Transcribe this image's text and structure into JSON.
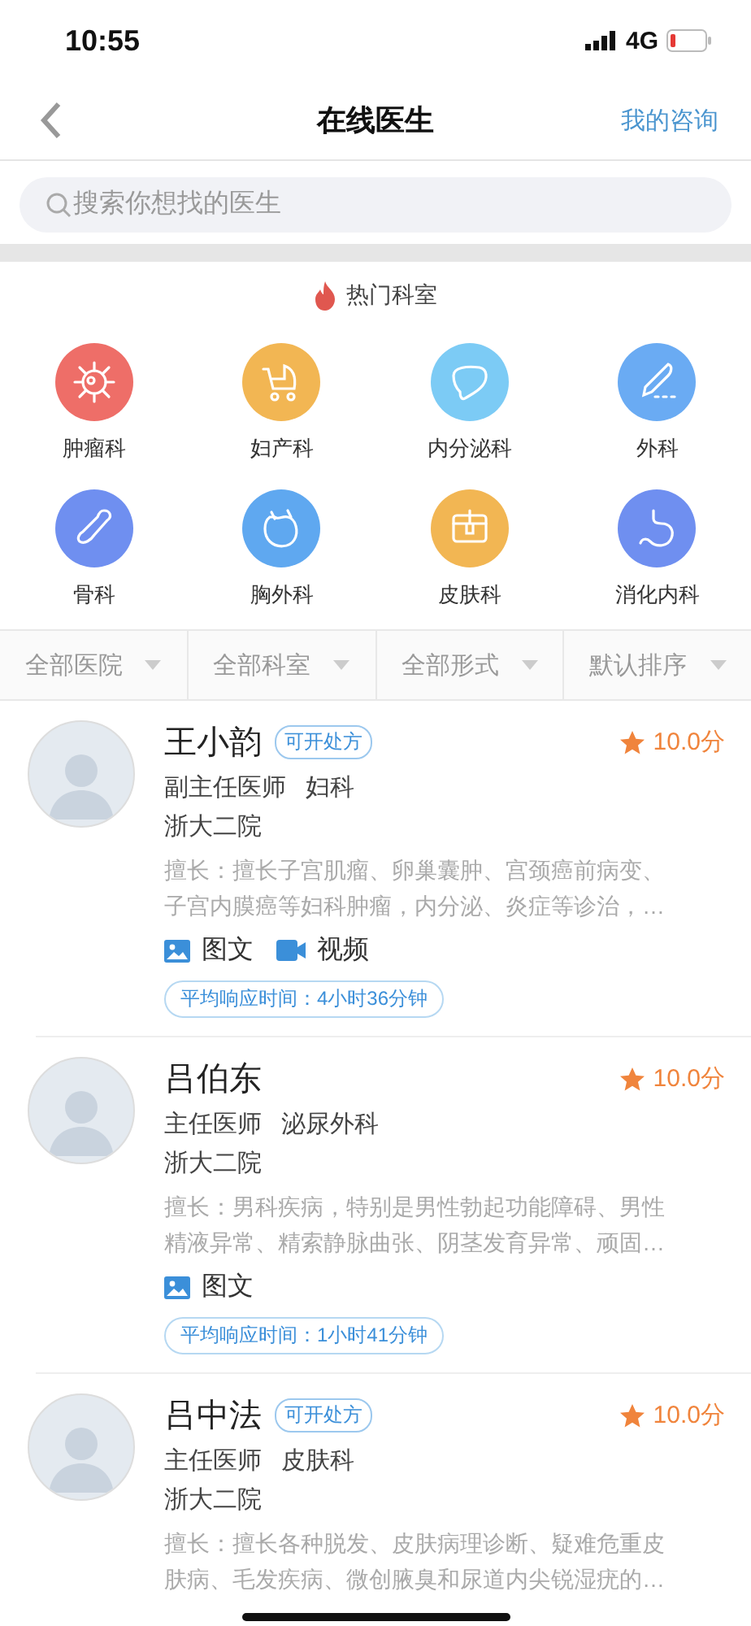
{
  "status_bar": {
    "time": "10:55",
    "network": "4G"
  },
  "nav": {
    "title": "在线医生",
    "action": "我的咨询"
  },
  "search": {
    "placeholder": "搜索你想找的医生"
  },
  "hot_departments": {
    "title": "热门科室",
    "items": [
      {
        "label": "肿瘤科",
        "kind": "virus",
        "color": "#ee6e68"
      },
      {
        "label": "妇产科",
        "kind": "stroller",
        "color": "#f2b653"
      },
      {
        "label": "内分泌科",
        "kind": "liver",
        "color": "#7ccbf5"
      },
      {
        "label": "外科",
        "kind": "scalpel",
        "color": "#6aabf3"
      },
      {
        "label": "骨科",
        "kind": "bone",
        "color": "#6f8ff0"
      },
      {
        "label": "胸外科",
        "kind": "heart",
        "color": "#5fa8f0"
      },
      {
        "label": "皮肤科",
        "kind": "skin",
        "color": "#f2b653"
      },
      {
        "label": "消化内科",
        "kind": "stomach",
        "color": "#6f8ff0"
      }
    ]
  },
  "filters": [
    {
      "label": "全部医院"
    },
    {
      "label": "全部科室"
    },
    {
      "label": "全部形式"
    },
    {
      "label": "默认排序"
    }
  ],
  "doctors": [
    {
      "name": "王小韵",
      "badge": "可开处方",
      "rating": "10.0分",
      "title": "副主任医师",
      "department": "妇科",
      "hospital": "浙大二院",
      "expertise": [
        "擅长：擅长子宫肌瘤、卵巢囊肿、宫颈癌前病变、",
        "子宫内膜癌等妇科肿瘤，内分泌、炎症等诊治，…"
      ],
      "consult_modes": [
        {
          "kind": "image",
          "label": "图文"
        },
        {
          "kind": "video",
          "label": "视频"
        }
      ],
      "response_time": "平均响应时间：4小时36分钟"
    },
    {
      "name": "吕伯东",
      "rating": "10.0分",
      "title": "主任医师",
      "department": "泌尿外科",
      "hospital": "浙大二院",
      "expertise": [
        "擅长：男科疾病，特别是男性勃起功能障碍、男性",
        "精液异常、精索静脉曲张、阴茎发育异常、顽固…"
      ],
      "consult_modes": [
        {
          "kind": "image",
          "label": "图文"
        }
      ],
      "response_time": "平均响应时间：1小时41分钟"
    },
    {
      "name": "吕中法",
      "badge": "可开处方",
      "rating": "10.0分",
      "title": "主任医师",
      "department": "皮肤科",
      "hospital": "浙大二院",
      "expertise": [
        "擅长：擅长各种脱发、皮肤病理诊断、疑难危重皮",
        "肤病、毛发疾病、微创腋臭和尿道内尖锐湿疣的…"
      ]
    }
  ]
}
